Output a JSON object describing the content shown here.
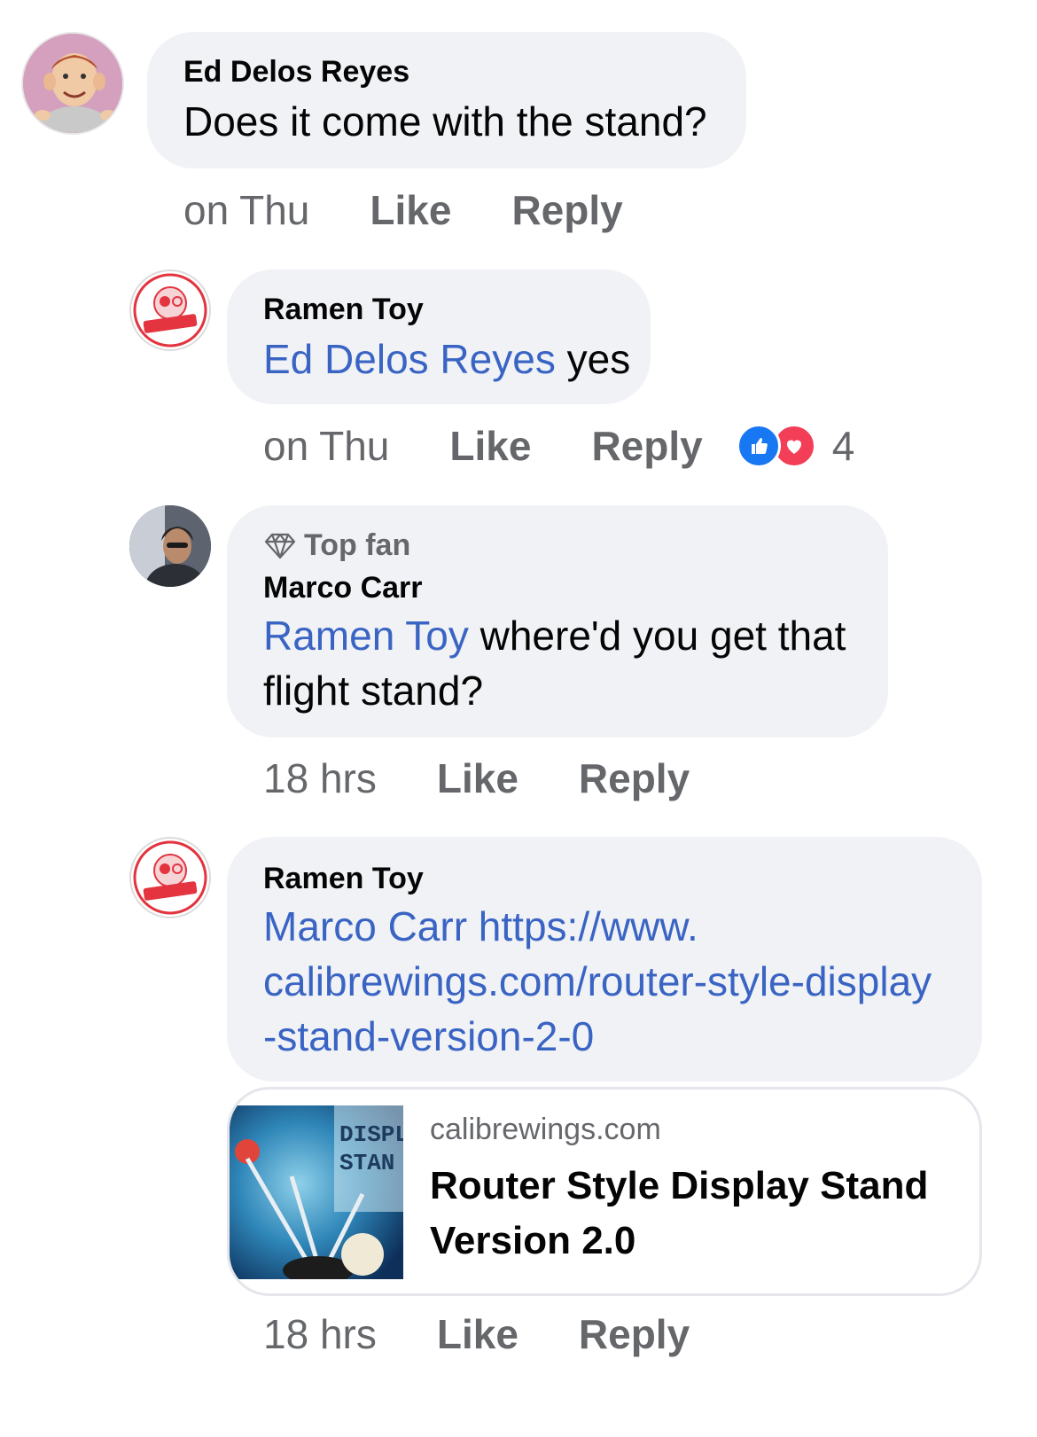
{
  "comments": [
    {
      "author": "Ed Delos Reyes",
      "text": "Does it come with the stand?",
      "time": "on Thu",
      "like_label": "Like",
      "reply_label": "Reply"
    },
    {
      "author": "Ramen Toy",
      "mention": "Ed Delos Reyes",
      "text": " yes",
      "time": "on Thu",
      "like_label": "Like",
      "reply_label": "Reply",
      "reaction_count": "4",
      "reaction_icons": [
        "like-reaction-icon",
        "love-reaction-icon"
      ]
    },
    {
      "badge": "Top fan",
      "author": "Marco Carr",
      "mention": "Ramen Toy",
      "text": " where'd you get that flight stand?",
      "time": "18 hrs",
      "like_label": "Like",
      "reply_label": "Reply"
    },
    {
      "author": "Ramen Toy",
      "mention": "Marco Carr",
      "link_line1": " https://www.",
      "link_line2": "calibrewings.com/router-style-display",
      "link_line3": "-stand-version-2-0",
      "time": "18 hrs",
      "like_label": "Like",
      "reply_label": "Reply",
      "preview": {
        "domain": "calibrewings.com",
        "title": "Router Style Display Stand Version 2.0",
        "thumb_text_1": "DISPL",
        "thumb_text_2": "STAN"
      }
    }
  ],
  "avatar_logo_text": "Ramen Toy",
  "colors": {
    "bubble": "#f0f2f5",
    "link": "#3a64c4",
    "meta": "#65676b",
    "like_blue": "#1877f2",
    "love_red": "#f33e58"
  }
}
